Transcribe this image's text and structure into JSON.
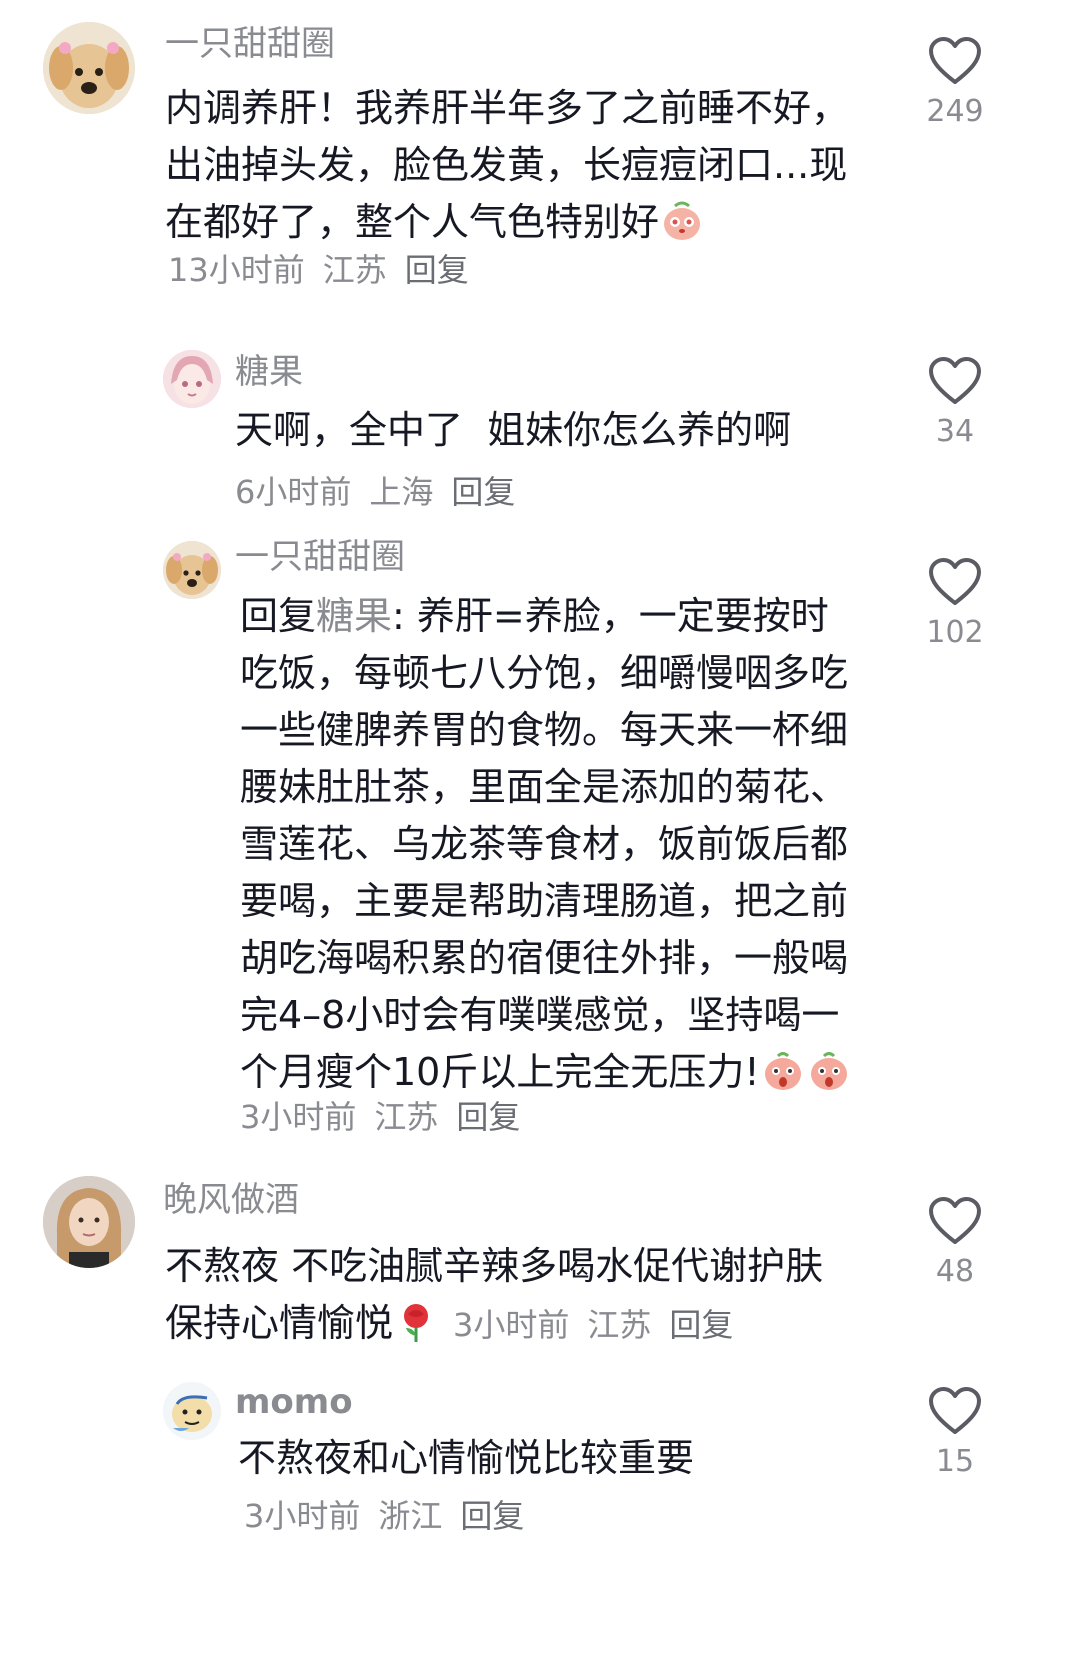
{
  "comments": [
    {
      "username": "一只甜甜圈",
      "text": "内调养肝！我养肝半年多了之前睡不好，出油掉头发，脸色发黄，长痘痘闭口...现在都好了，整个人气色特别好",
      "time": "13小时前",
      "location": "江苏",
      "reply_label": "回复",
      "likes": "249",
      "emoji": "shy-face-emoji"
    },
    {
      "username": "糖果",
      "text": "天啊，全中了  姐妹你怎么养的啊",
      "time": "6小时前",
      "location": "上海",
      "reply_label": "回复",
      "likes": "34"
    },
    {
      "username": "一只甜甜圈",
      "reply_prefix": "回复",
      "mention": "糖果",
      "text": ": 养肝=养脸，一定要按时吃饭，每顿七八分饱，细嚼慢咽多吃一些健脾养胃的食物。每天来一杯细腰妹肚肚茶，里面全是添加的菊花、雪莲花、乌龙茶等食材，饭前饭后都要喝，主要是帮助清理肠道，把之前胡吃海喝积累的宿便往外排，一般喝完4–8小时会有噗噗感觉，坚持喝一个月瘦个10斤以上完全无压力!",
      "time": "3小时前",
      "location": "江苏",
      "reply_label": "回复",
      "likes": "102",
      "emoji": "shocked-face-emoji"
    },
    {
      "username": "晚风做酒",
      "text": "不熬夜  不吃油腻辛辣多喝水促代谢护肤保持心情愉悦",
      "time": "3小时前",
      "location": "江苏",
      "reply_label": "回复",
      "likes": "48",
      "emoji": "rose-emoji"
    },
    {
      "username": "momo",
      "text": "不熬夜和心情愉悦比较重要",
      "time": "3小时前",
      "location": "浙江",
      "reply_label": "回复",
      "likes": "15"
    }
  ],
  "icons": {
    "like": "heart-outline-icon"
  },
  "colors": {
    "text": "#161823",
    "secondary": "#8a8b91",
    "icon": "#5b5c63"
  }
}
